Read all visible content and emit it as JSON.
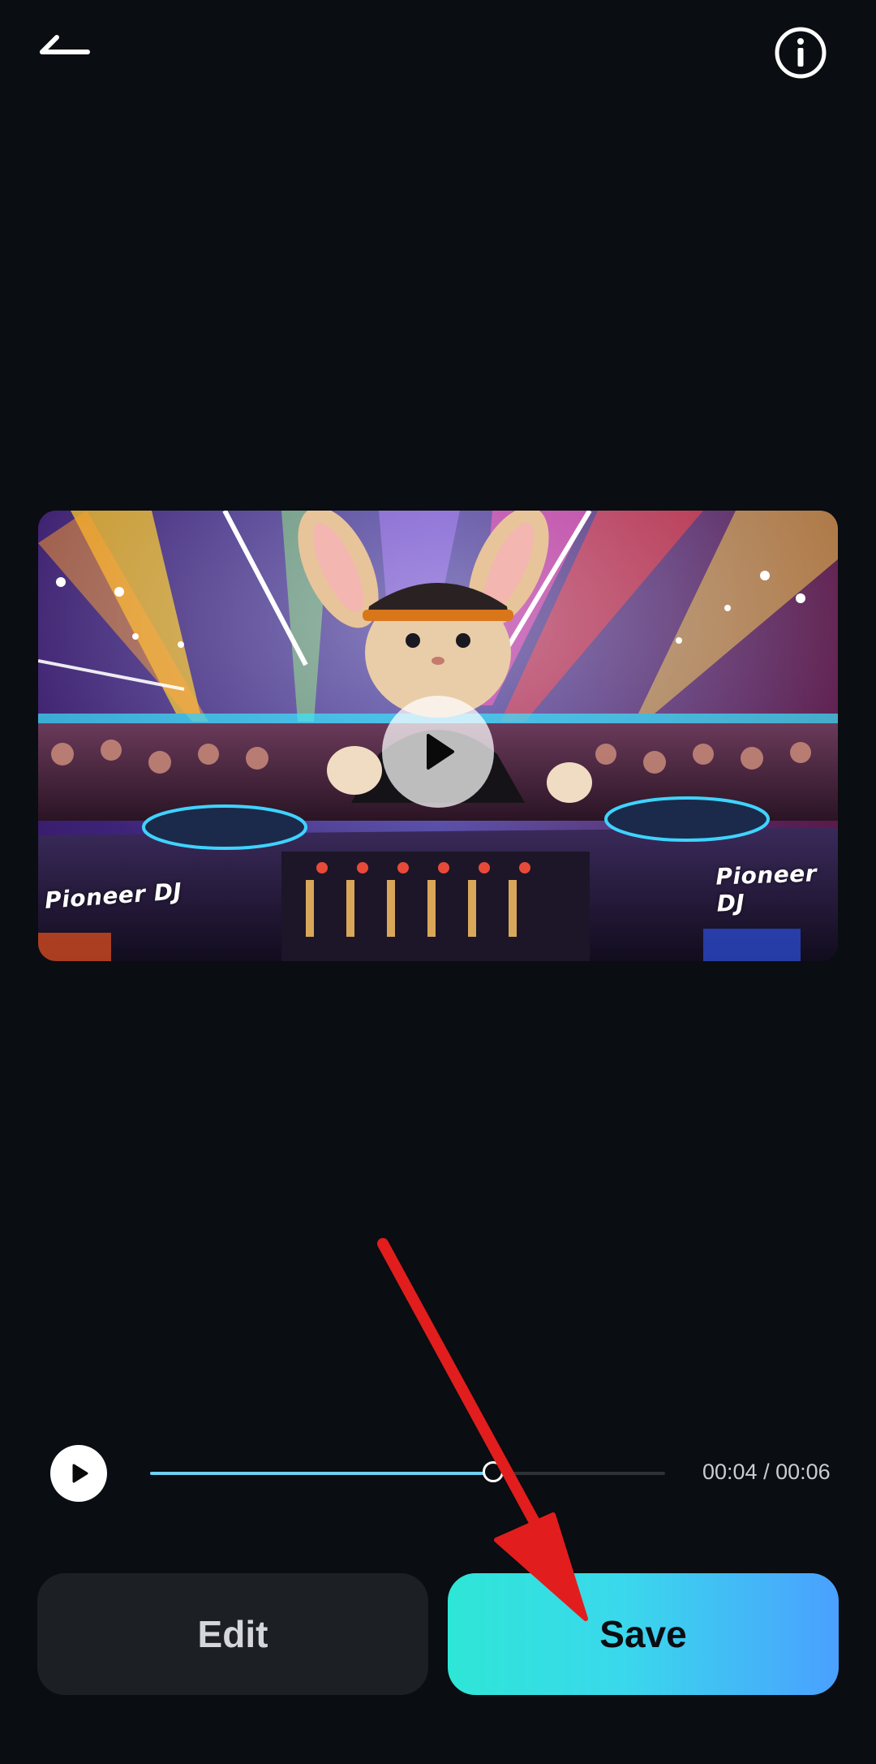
{
  "header": {
    "back_icon": "back-arrow-icon",
    "info_icon": "info-circle-icon"
  },
  "video": {
    "brand_left": "Pioneer DJ",
    "brand_right": "Pioneer DJ",
    "play_icon": "play-icon"
  },
  "player": {
    "play_icon": "play-icon",
    "progress": 0.67,
    "time_label": "00:04 / 00:06",
    "accent": "#6fd0f2"
  },
  "actions": {
    "edit_label": "Edit",
    "save_label": "Save"
  },
  "annotation": {
    "arrow_color": "#e21d1d"
  }
}
